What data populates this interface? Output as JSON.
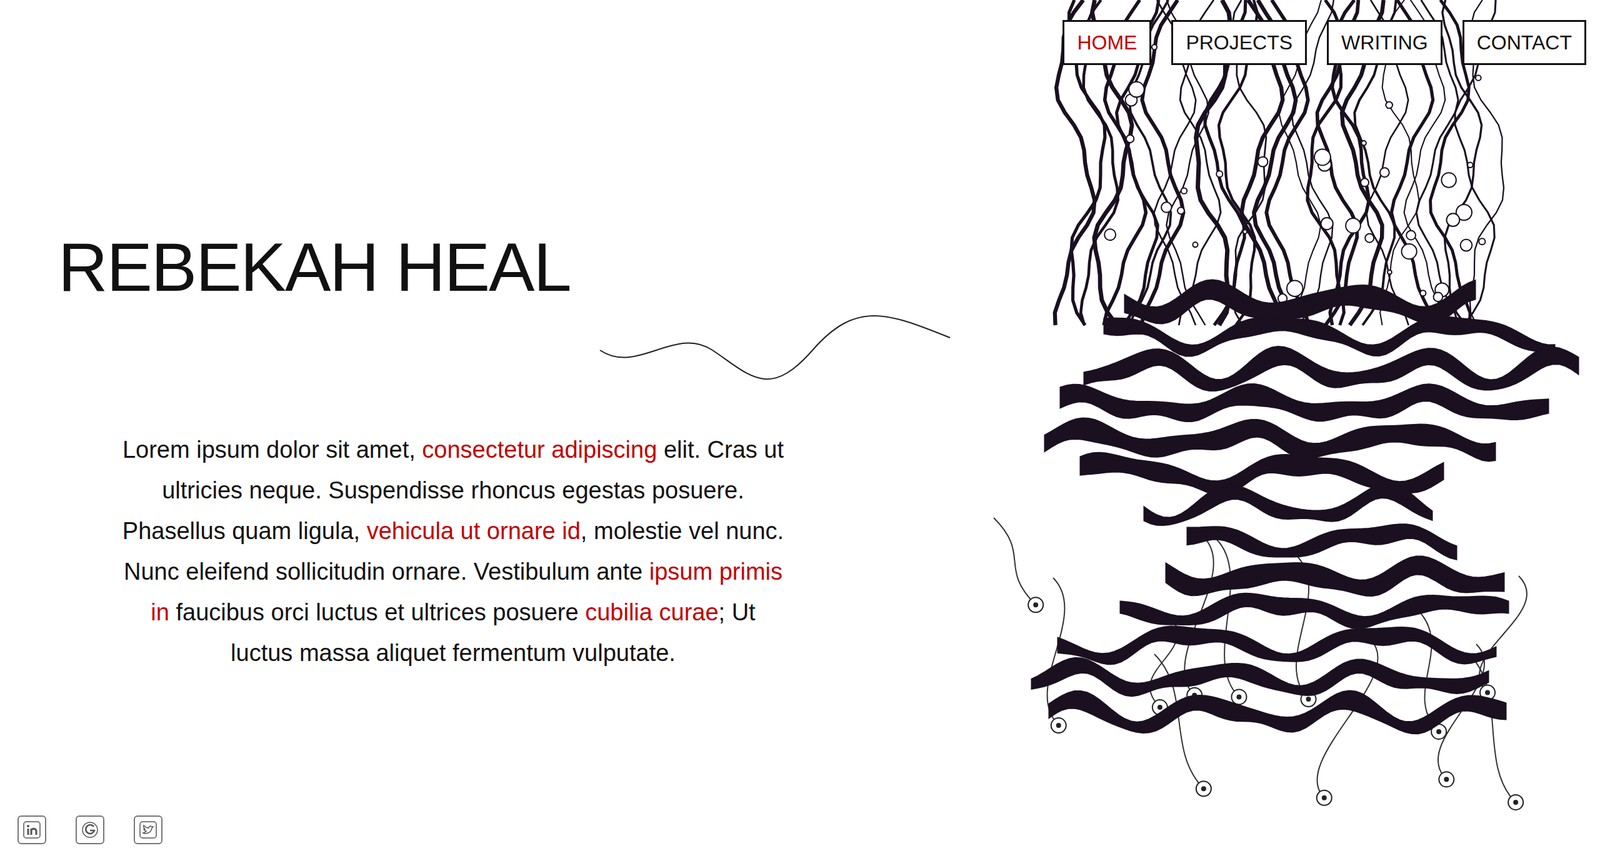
{
  "nav": [
    {
      "label": "HOME",
      "selected": true
    },
    {
      "label": "PROJECTS",
      "selected": false
    },
    {
      "label": "WRITING",
      "selected": false
    },
    {
      "label": "CONTACT",
      "selected": false
    }
  ],
  "title": "REBEKAH HEAL",
  "intro": [
    {
      "text": "Lorem ipsum dolor sit amet, ",
      "link": false
    },
    {
      "text": "consectetur adipiscing",
      "link": true
    },
    {
      "text": " elit. Cras ut ultricies neque. Suspendisse rhoncus egestas posuere. Phasellus quam ligula, ",
      "link": false
    },
    {
      "text": "vehicula ut ornare id",
      "link": true
    },
    {
      "text": ", molestie vel nunc. Nunc eleifend sollicitudin ornare. Vestibulum ante ",
      "link": false
    },
    {
      "text": "ipsum primis in",
      "link": true
    },
    {
      "text": " faucibus orci luctus et ultrices posuere ",
      "link": false
    },
    {
      "text": "cubilia curae",
      "link": true
    },
    {
      "text": "; Ut luctus massa aliquet fermentum vulputate.",
      "link": false
    }
  ],
  "social": [
    {
      "kind": "linkedin"
    },
    {
      "kind": "google"
    },
    {
      "kind": "twitter"
    }
  ]
}
